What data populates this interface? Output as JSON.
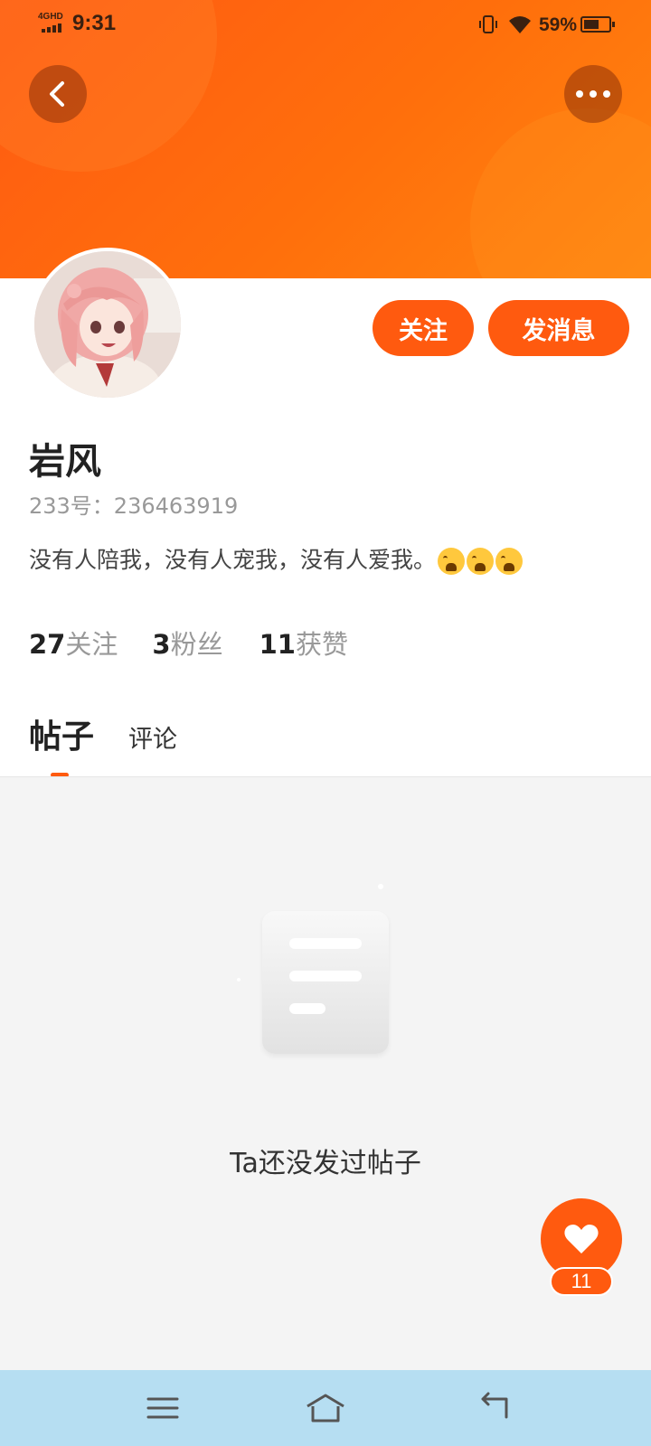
{
  "status_bar": {
    "network": "4GHD",
    "time": "9:31",
    "battery": "59%",
    "battery_level": 0.59
  },
  "header": {
    "back_icon": "chevron-left-icon",
    "more_icon": "more-dots-icon",
    "accent": "#ff5a0f"
  },
  "profile": {
    "avatar_icon": "avatar-anime-girl",
    "follow_label": "关注",
    "message_label": "发消息",
    "name": "岩风",
    "id_text": "233号：236463919",
    "bio": "没有人陪我，没有人宠我，没有人爱我。",
    "bio_emoji": "crying-face-icon"
  },
  "stats": {
    "following_count": "27",
    "following_label": "关注",
    "fans_count": "3",
    "fans_label": "粉丝",
    "likes_count": "11",
    "likes_label": "获赞"
  },
  "tabs": {
    "posts": "帖子",
    "comments": "评论"
  },
  "empty": {
    "text": "Ta还没发过帖子"
  },
  "like_button": {
    "count": "11"
  },
  "nav_bar": {
    "menu_icon": "menu-icon",
    "home_icon": "home-icon",
    "back_icon": "back-arrow-icon"
  }
}
